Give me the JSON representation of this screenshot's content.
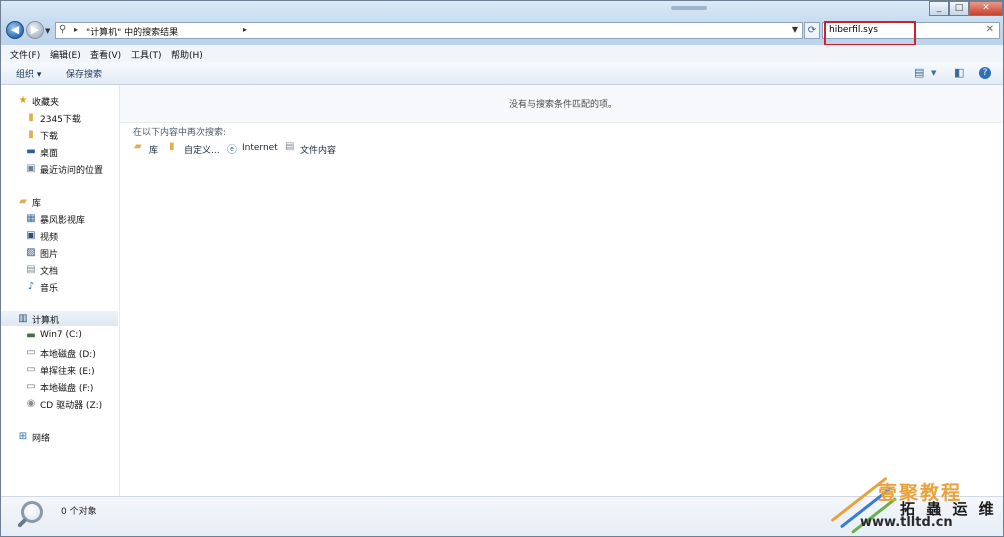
{
  "address_bar": {
    "breadcrumb": "\"计算机\" 中的搜索结果"
  },
  "search_box": {
    "value": "hiberfil.sys"
  },
  "menu": [
    "文件(F)",
    "编辑(E)",
    "查看(V)",
    "工具(T)",
    "帮助(H)"
  ],
  "toolbar": {
    "organize": "组织 ▾",
    "save_search": "保存搜索"
  },
  "sidebar": {
    "favorites": {
      "label": "收藏夹",
      "items": [
        "2345下载",
        "下载",
        "桌面",
        "最近访问的位置"
      ]
    },
    "libraries": {
      "label": "库",
      "items": [
        "暴风影视库",
        "视频",
        "图片",
        "文档",
        "音乐"
      ]
    },
    "computer": {
      "label": "计算机",
      "items": [
        "Win7 (C:)",
        "本地磁盘 (D:)",
        "单挥往来 (E:)",
        "本地磁盘 (F:)",
        "CD 驱动器 (Z:)"
      ]
    },
    "network": {
      "label": "网络"
    }
  },
  "content": {
    "no_results": "没有与搜索条件匹配的项。",
    "search_again": "在以下内容中再次搜索:",
    "options": [
      "库",
      "自定义...",
      "Internet",
      "文件内容"
    ]
  },
  "status": {
    "count": "0 个对象"
  },
  "watermark": {
    "line1": "壹聚教程",
    "line2": "拓 蟲 运 维",
    "line3": "www.tlltd.cn"
  },
  "colors": {
    "highlight_box": "#d0202a",
    "title_gradient": "#c3d8ee"
  }
}
